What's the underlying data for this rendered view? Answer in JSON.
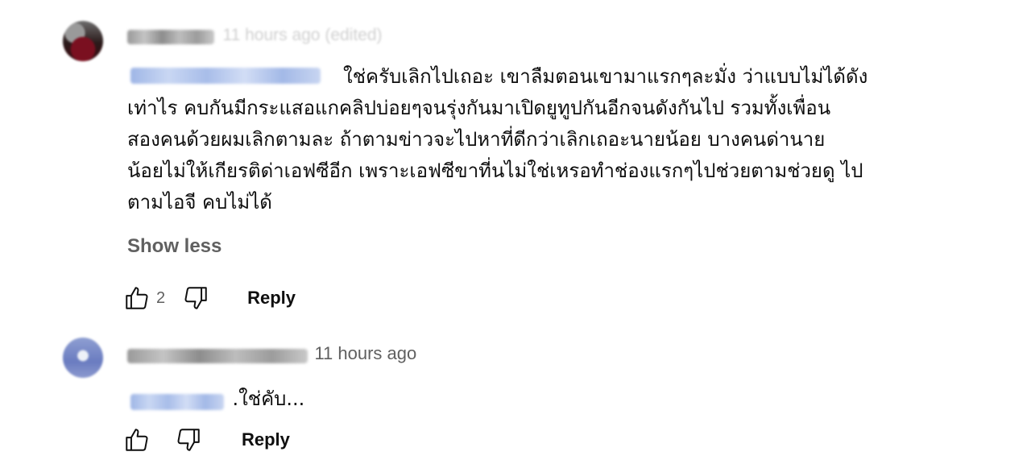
{
  "comment1": {
    "author": "@hsb691",
    "timestamp": "11 hours ago (edited)",
    "mention": "@somegirl1k0gk1",
    "body_lines": [
      "ใช่ครับเลิกไปเถอะ เขาลืมตอนเขามาแรกๆละมั่ง ว่าแบบไม่ได้ดัง",
      "เท่าไร คบกันมีกระแสอแกคลิปบ่อยๆจนรุ่งกันมาเปิดยูทูปกันอีกจนดังกันไป รวมทั้งเพื่อน",
      "สองคนด้วยผมเลิกตามละ ถ้าตามข่าวจะไปหาที่ดีกว่าเลิกเถอะนายน้อย บางคนด่านาย",
      "น้อยไม่ให้เกียรติด่าเอฟซีอีก เพราะเอฟซีขาที่นไม่ใช่เหรอทำช่องแรกๆไปช่วยตามช่วยดู ไป",
      "ตามไอจี คบไม่ได้"
    ],
    "show_less_label": "Show less",
    "like_count": "2",
    "reply_label": "Reply"
  },
  "comment2": {
    "author": "@somegirl1k0gk1",
    "timestamp": "11 hours ago",
    "mention": "@hsb691",
    "body": ".ใช่คับ...",
    "reply_label": "Reply"
  },
  "icons": {
    "like": "thumbs-up-icon",
    "dislike": "thumbs-down-icon"
  },
  "colors": {
    "text_primary": "#0f0f0f",
    "text_secondary": "#606060",
    "mention_blue": "#065fd4"
  }
}
